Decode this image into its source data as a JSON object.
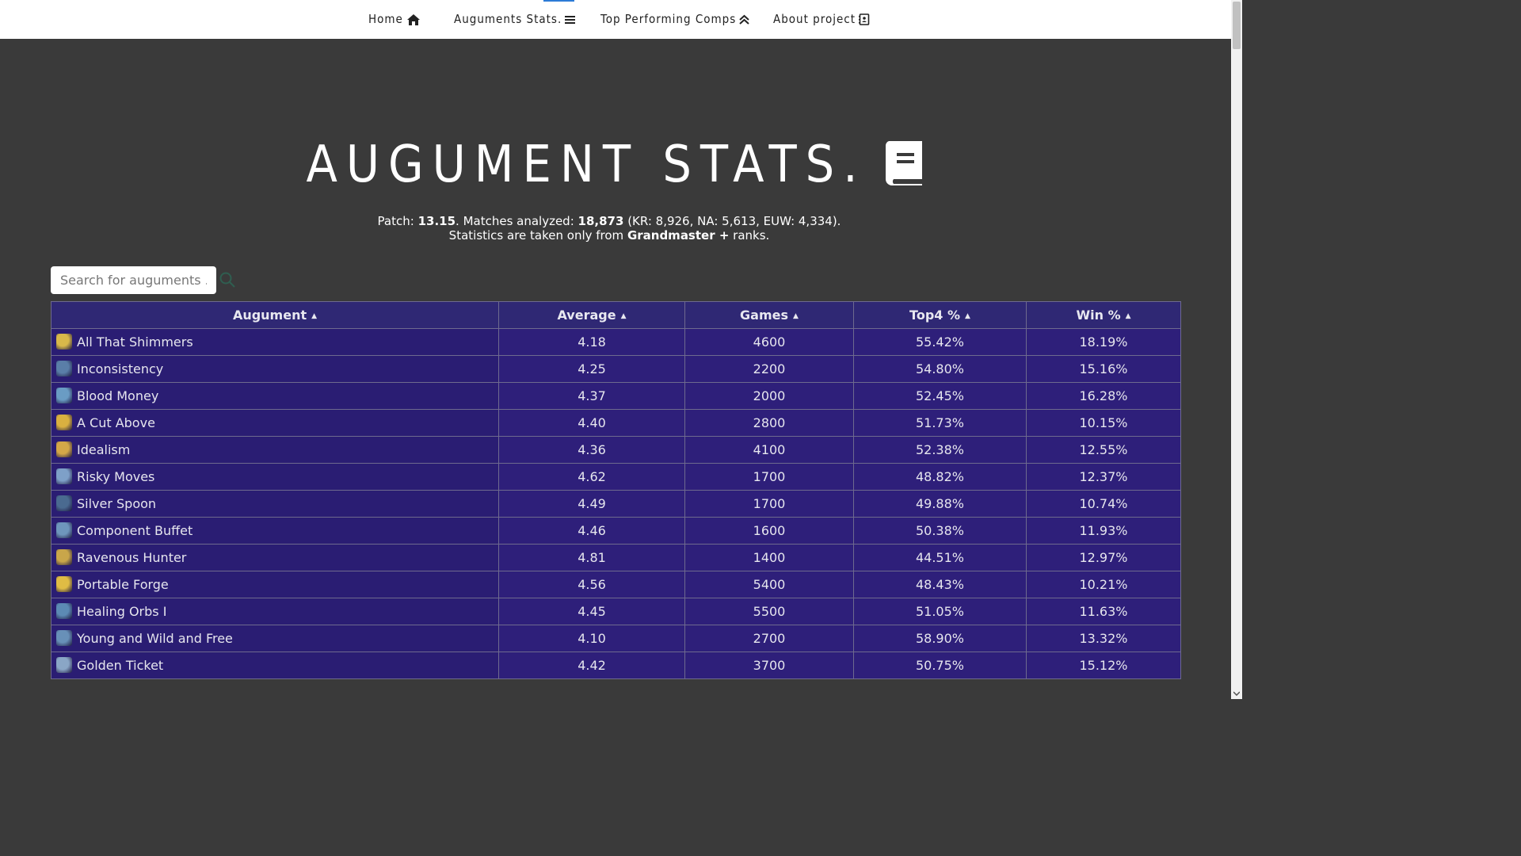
{
  "nav": {
    "items": [
      {
        "label": "Home",
        "icon": "home-icon"
      },
      {
        "label": "Auguments Stats.",
        "icon": "menu-icon"
      },
      {
        "label": "Top Performing Comps",
        "icon": "double-chevron-up-icon"
      },
      {
        "label": "About project",
        "icon": "contact-card-icon"
      }
    ]
  },
  "page": {
    "title": "AUGUMENT STATS.",
    "title_icon": "book-icon"
  },
  "summary": {
    "patch_label": "Patch: ",
    "patch": "13.15",
    "matches_label": ". Matches analyzed: ",
    "matches": "18,873",
    "regions": " (KR: 8,926, NA: 5,613, EUW: 4,334).",
    "ranks_prefix": "Statistics are taken only from ",
    "ranks": "Grandmaster +",
    "ranks_suffix": " ranks."
  },
  "search": {
    "placeholder": "Search for auguments ...",
    "value": ""
  },
  "table": {
    "columns": [
      "Augument",
      "Average",
      "Games",
      "Top4 %",
      "Win %"
    ],
    "rows": [
      {
        "name": "All That Shimmers",
        "average": "4.18",
        "games": "4600",
        "top4": "55.42%",
        "win": "18.19%",
        "icon_color": "#d8b84a"
      },
      {
        "name": "Inconsistency",
        "average": "4.25",
        "games": "2200",
        "top4": "54.80%",
        "win": "15.16%",
        "icon_color": "#5a7ea8"
      },
      {
        "name": "Blood Money",
        "average": "4.37",
        "games": "2000",
        "top4": "52.45%",
        "win": "16.28%",
        "icon_color": "#6a9cc4"
      },
      {
        "name": "A Cut Above",
        "average": "4.40",
        "games": "2800",
        "top4": "51.73%",
        "win": "10.15%",
        "icon_color": "#d9b040"
      },
      {
        "name": "Idealism",
        "average": "4.36",
        "games": "4100",
        "top4": "52.38%",
        "win": "12.55%",
        "icon_color": "#d4a848"
      },
      {
        "name": "Risky Moves",
        "average": "4.62",
        "games": "1700",
        "top4": "48.82%",
        "win": "12.37%",
        "icon_color": "#7ea0c8"
      },
      {
        "name": "Silver Spoon",
        "average": "4.49",
        "games": "1700",
        "top4": "49.88%",
        "win": "10.74%",
        "icon_color": "#4a6a90"
      },
      {
        "name": "Component Buffet",
        "average": "4.46",
        "games": "1600",
        "top4": "50.38%",
        "win": "11.93%",
        "icon_color": "#6e96bc"
      },
      {
        "name": "Ravenous Hunter",
        "average": "4.81",
        "games": "1400",
        "top4": "44.51%",
        "win": "12.97%",
        "icon_color": "#c9a64a"
      },
      {
        "name": "Portable Forge",
        "average": "4.56",
        "games": "5400",
        "top4": "48.43%",
        "win": "10.21%",
        "icon_color": "#e0bc44"
      },
      {
        "name": "Healing Orbs I",
        "average": "4.45",
        "games": "5500",
        "top4": "51.05%",
        "win": "11.63%",
        "icon_color": "#5c8ab4"
      },
      {
        "name": "Young and Wild and Free",
        "average": "4.10",
        "games": "2700",
        "top4": "58.90%",
        "win": "13.32%",
        "icon_color": "#6890b8"
      },
      {
        "name": "Golden Ticket",
        "average": "4.42",
        "games": "3700",
        "top4": "50.75%",
        "win": "15.12%",
        "icon_color": "#8aa6c6"
      }
    ]
  }
}
